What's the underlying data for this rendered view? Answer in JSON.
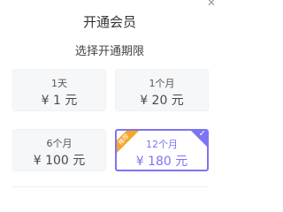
{
  "header": {
    "title": "开通会员",
    "subtitle": "选择开通期限"
  },
  "plans": [
    {
      "label": "1天",
      "price": "¥ 1 元"
    },
    {
      "label": "1个月",
      "price": "¥ 20 元"
    },
    {
      "label": "6个月",
      "price": "¥ 100 元"
    },
    {
      "label": "12个月",
      "price": "¥ 180 元",
      "badge": "推荐"
    }
  ],
  "icons": {
    "close": "close-icon",
    "check": "check-icon"
  },
  "colors": {
    "accent": "#7d74f2",
    "badge": "#f4a52c",
    "card_bg": "#f6f7f9"
  }
}
